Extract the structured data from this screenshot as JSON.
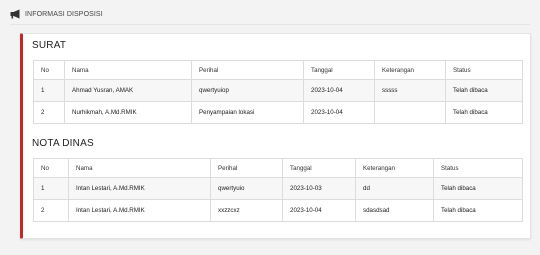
{
  "header": {
    "title": "INFORMASI DISPOSISI",
    "icon": "megaphone-icon"
  },
  "surat": {
    "title": "SURAT",
    "columns": [
      "No",
      "Nama",
      "Perihal",
      "Tanggal",
      "Keterangan",
      "Status"
    ],
    "rows": [
      [
        "1",
        "Ahmad Yusran, AMAK",
        "qwertyuiop",
        "2023-10-04",
        "sssss",
        "Telah dibaca"
      ],
      [
        "2",
        "Nurhikmah, A.Md.RMIK",
        "Penyampaian lokasi",
        "2023-10-04",
        "",
        "Telah dibaca"
      ]
    ]
  },
  "nota_dinas": {
    "title": "NOTA DINAS",
    "columns": [
      "No",
      "Nama",
      "Perihal",
      "Tanggal",
      "Keterangan",
      "Status"
    ],
    "rows": [
      [
        "1",
        "Intan Lestari, A.Md.RMIK",
        "qwertyuio",
        "2023-10-03",
        "dd",
        "Telah dibaca"
      ],
      [
        "2",
        "Intan Lestari, A.Md.RMIK",
        "xxzzcxz",
        "2023-10-04",
        "sdasdsad",
        "Telah dibaca"
      ]
    ]
  },
  "colors": {
    "accent": "#c62828",
    "border": "#dcdcdc",
    "stripe": "#f7f7f7"
  }
}
